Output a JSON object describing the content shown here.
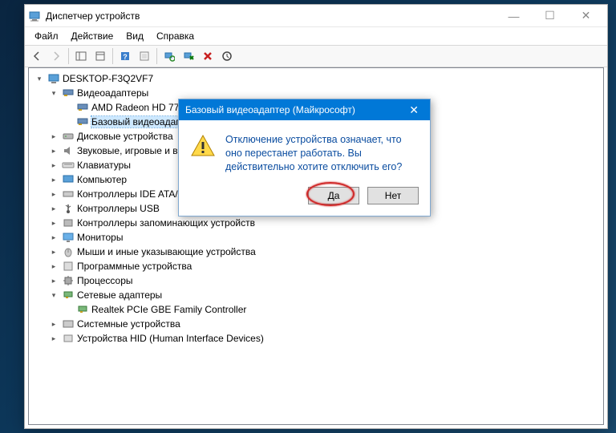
{
  "window": {
    "title": "Диспетчер устройств",
    "controls": {
      "min": "—",
      "max": "☐",
      "close": "✕"
    }
  },
  "menu": {
    "file": "Файл",
    "action": "Действие",
    "view": "Вид",
    "help": "Справка"
  },
  "tree": {
    "root": "DESKTOP-F3Q2VF7",
    "video": {
      "label": "Видеоадаптеры",
      "children": [
        "AMD Radeon HD 7700 Series",
        "Базовый видеоадаптер (Майкрософт)"
      ]
    },
    "disk": "Дисковые устройства",
    "sound": "Звуковые, игровые и видеоустройства",
    "keyboards": "Клавиатуры",
    "computer": "Компьютер",
    "ide": "Контроллеры IDE ATA/ATAPI",
    "usb": "Контроллеры USB",
    "storage": "Контроллеры запоминающих устройств",
    "monitors": "Мониторы",
    "mice": "Мыши и иные указывающие устройства",
    "software": "Программные устройства",
    "cpu": "Процессоры",
    "net": {
      "label": "Сетевые адаптеры",
      "children": [
        "Realtek PCIe GBE Family Controller"
      ]
    },
    "system": "Системные устройства",
    "hid": "Устройства HID (Human Interface Devices)"
  },
  "dialog": {
    "title": "Базовый видеоадаптер (Майкрософт)",
    "message": "Отключение устройства означает, что оно перестанет работать. Вы действительно хотите отключить его?",
    "yes": "Да",
    "no": "Нет"
  }
}
